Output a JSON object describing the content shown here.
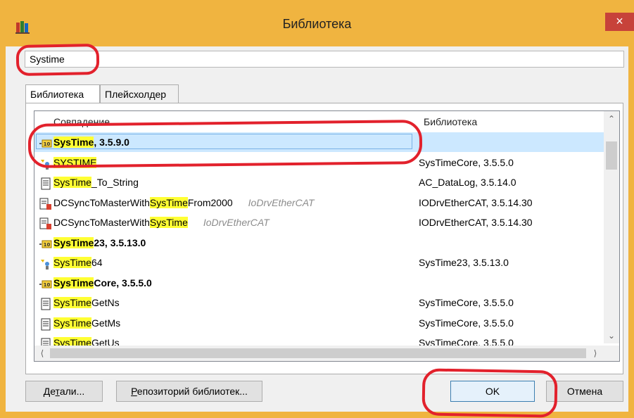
{
  "window": {
    "title": "Библиотека",
    "close_label": "×",
    "accent_color": "#f0b440",
    "close_color": "#c7423a"
  },
  "search": {
    "value": "Systime"
  },
  "tabs": [
    {
      "label": "Библиотека",
      "active": true
    },
    {
      "label": "Плейсхолдер",
      "active": false
    }
  ],
  "columns": {
    "match": "Совпадение",
    "library": "Библиотека"
  },
  "results": [
    {
      "icon": "library-package-icon",
      "pre": "",
      "hl": "SysTime",
      "post": ", 3.5.9.0",
      "bold": true,
      "context": "",
      "library": "",
      "selected": true
    },
    {
      "icon": "enum-type-icon",
      "pre": "",
      "hl": "SYSTIME",
      "post": "",
      "bold": false,
      "context": "",
      "library": "SysTimeCore, 3.5.5.0"
    },
    {
      "icon": "function-document-icon",
      "pre": "",
      "hl": "SysTime",
      "post": "_To_String",
      "bold": false,
      "context": "",
      "library": "AC_DataLog, 3.5.14.0"
    },
    {
      "icon": "function-block-icon",
      "pre": "DCSyncToMasterWith",
      "hl": "SysTime",
      "post": "From2000",
      "bold": false,
      "context": "IoDrvEtherCAT",
      "library": "IODrvEtherCAT, 3.5.14.30"
    },
    {
      "icon": "function-block-icon",
      "pre": "DCSyncToMasterWith",
      "hl": "SysTime",
      "post": "",
      "bold": false,
      "context": "IoDrvEtherCAT",
      "library": "IODrvEtherCAT, 3.5.14.30"
    },
    {
      "icon": "library-package-icon",
      "pre": "",
      "hl": "SysTime",
      "post": "23, 3.5.13.0",
      "bold": true,
      "context": "",
      "library": ""
    },
    {
      "icon": "enum-type-icon",
      "pre": "",
      "hl": "SysTime",
      "post": "64",
      "bold": false,
      "context": "",
      "library": "SysTime23, 3.5.13.0"
    },
    {
      "icon": "library-package-icon",
      "pre": "",
      "hl": "SysTime",
      "post": "Core, 3.5.5.0",
      "bold": true,
      "context": "",
      "library": ""
    },
    {
      "icon": "function-document-icon",
      "pre": "",
      "hl": "SysTime",
      "post": "GetNs",
      "bold": false,
      "context": "",
      "library": "SysTimeCore, 3.5.5.0"
    },
    {
      "icon": "function-document-icon",
      "pre": "",
      "hl": "SysTime",
      "post": "GetMs",
      "bold": false,
      "context": "",
      "library": "SysTimeCore, 3.5.5.0"
    },
    {
      "icon": "function-document-icon",
      "pre": "",
      "hl": "SysTime",
      "post": "GetUs",
      "bold": false,
      "context": "",
      "library": "SysTimeCore, 3.5.5.0"
    }
  ],
  "buttons": {
    "details": {
      "pre": "Де",
      "ul": "т",
      "post": "али..."
    },
    "repository": {
      "pre": "",
      "ul": "Р",
      "post": "епозиторий библиотек..."
    },
    "ok": "OK",
    "cancel": "Отмена"
  },
  "highlight_color": "#ffff33",
  "annotation_color": "#e2212c"
}
